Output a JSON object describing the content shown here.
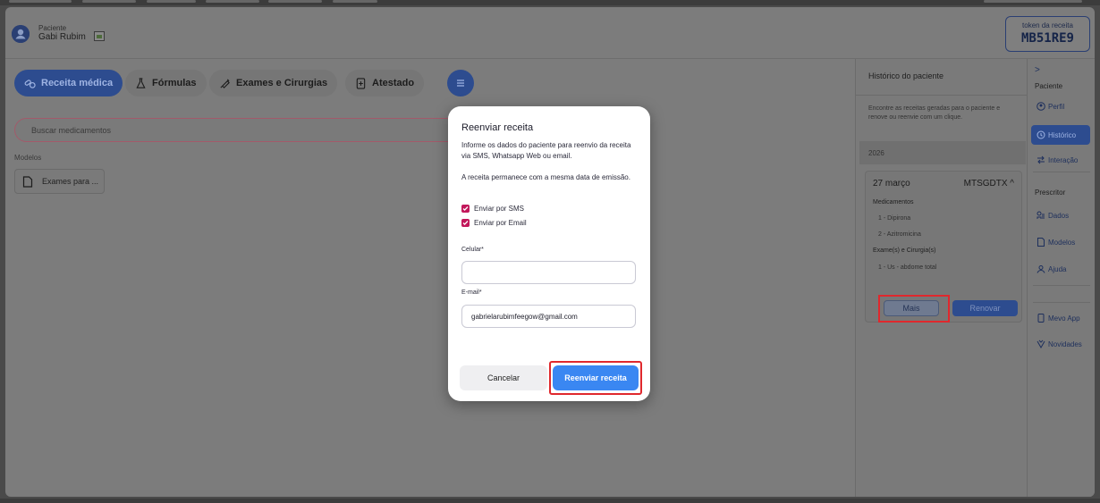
{
  "header": {
    "patient_label": "Paciente",
    "patient_name": "Gabi Rubim",
    "token_label": "token da receita",
    "token_value": "MB51RE9"
  },
  "tabs": [
    {
      "label": "Receita médica",
      "icon": "pills-icon",
      "active": true
    },
    {
      "label": "Fórmulas",
      "icon": "flask-icon",
      "active": false
    },
    {
      "label": "Exames e Cirurgias",
      "icon": "syringe-icon",
      "active": false
    },
    {
      "label": "Atestado",
      "icon": "document-plus-icon",
      "active": false
    }
  ],
  "search": {
    "placeholder": "Buscar medicamentos"
  },
  "models": {
    "label": "Modelos",
    "items": [
      {
        "label": "Exames para ..."
      }
    ]
  },
  "history": {
    "title": "Histórico do paciente",
    "description": "Encontre as receitas geradas para o paciente e renove ou reenvie com um clique.",
    "year": "2026",
    "card": {
      "date": "27 março",
      "code": "MTSGDTX ^",
      "medications_label": "Medicamentos",
      "medications": [
        "1 - Dipirona",
        "2 - Azitromicina"
      ],
      "exams_label": "Exame(s) e Cirurgia(s)",
      "exams": [
        "1 - Us - abdome total"
      ],
      "more_label": "Mais",
      "renew_label": "Renovar"
    }
  },
  "sidebar": {
    "chevron": ">",
    "group_paciente": "Paciente",
    "items_paciente": [
      {
        "label": "Perfil",
        "icon": "user-circle-icon"
      },
      {
        "label": "Histórico",
        "icon": "history-icon",
        "active": true
      },
      {
        "label": "Interação",
        "icon": "arrows-icon"
      }
    ],
    "group_prescritor": "Prescritor",
    "items_prescritor": [
      {
        "label": "Dados",
        "icon": "data-icon"
      },
      {
        "label": "Modelos",
        "icon": "file-icon"
      },
      {
        "label": "Ajuda",
        "icon": "help-icon"
      }
    ],
    "items_extra": [
      {
        "label": "Mevo App",
        "icon": "phone-icon"
      },
      {
        "label": "Novidades",
        "icon": "gift-icon"
      }
    ]
  },
  "modal": {
    "title": "Reenviar receita",
    "text1": "Informe os dados do paciente para reenvio da receita via SMS, Whatsapp Web ou email.",
    "text2": "A receita permanece com a mesma data de emissão.",
    "check_sms": "Enviar por SMS",
    "check_email": "Enviar por Email",
    "phone_label": "Celular*",
    "phone_value": "",
    "email_label": "E-mail*",
    "email_value": "gabrielarubimfeegow@gmail.com",
    "cancel_label": "Cancelar",
    "submit_label": "Reenviar receita"
  },
  "colors": {
    "primary": "#2d4c8f",
    "submit": "#3a87f2",
    "check": "#c2185b",
    "highlight": "#e0282d"
  }
}
